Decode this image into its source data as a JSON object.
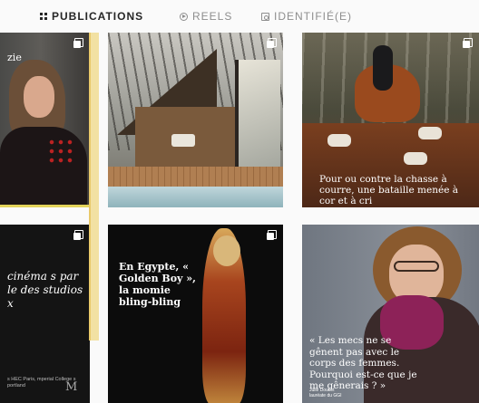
{
  "tabs": [
    {
      "label": "PUBLICATIONS",
      "icon": "grid-icon",
      "active": true
    },
    {
      "label": "REELS",
      "icon": "reels-icon",
      "active": false
    },
    {
      "label": "IDENTIFIÉ(E)",
      "icon": "tagged-icon",
      "active": false
    }
  ],
  "posts": [
    {
      "caption": "zie",
      "multi": true
    },
    {
      "caption": "",
      "multi": true
    },
    {
      "caption": "Pour ou contre la chasse à courre, une bataille menée à cor et à cri",
      "multi": true
    },
    {
      "caption": "cinéma s par le des studios x",
      "footer": "s HEC Paris, mperial College s portland",
      "logo": "M",
      "multi": true
    },
    {
      "caption": "En Egypte, « Golden Boy », la momie bling-bling",
      "multi": true
    },
    {
      "caption": "« Les mecs ne se gênent pas avec le corps des femmes. Pourquoi est-ce que je me gênerais ? »",
      "credit": "Julie Doucet",
      "credit_sub": "lauréate du GGI",
      "multi": false
    }
  ],
  "colors": {
    "highlight": "#f2e1a3",
    "active_tab": "#262626",
    "inactive_tab": "#8e8e8e"
  }
}
